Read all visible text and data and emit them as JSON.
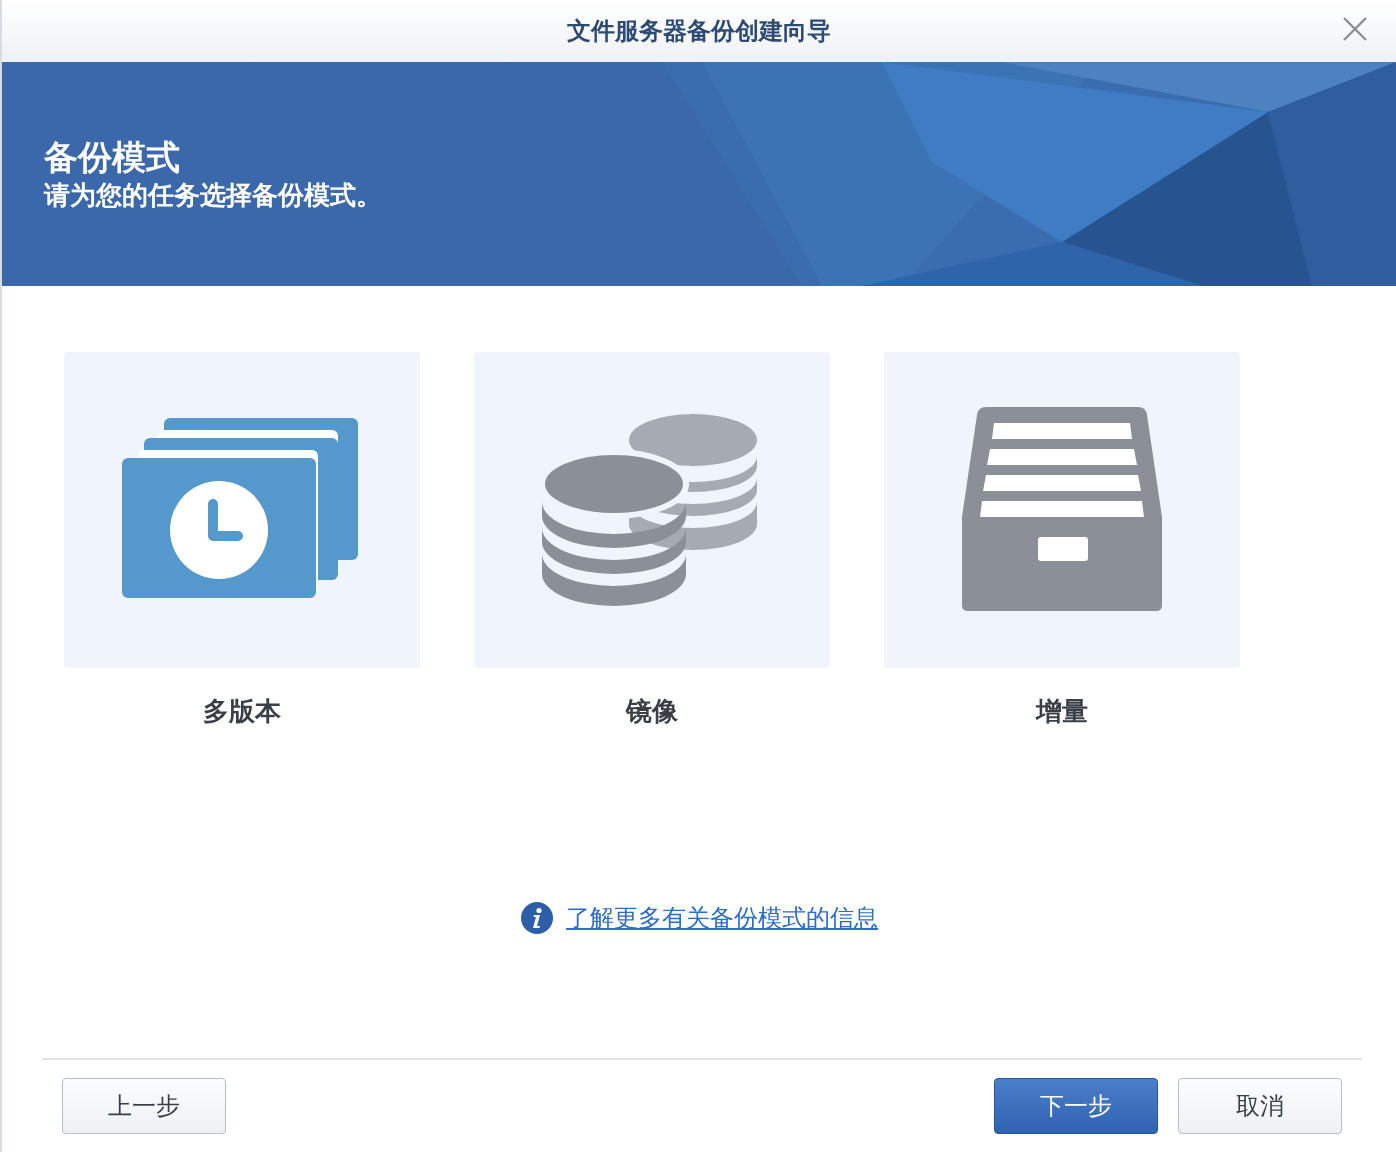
{
  "window": {
    "title": "文件服务器备份创建向导"
  },
  "banner": {
    "title": "备份模式",
    "subtitle": "请为您的任务选择备份模式。"
  },
  "modes": [
    {
      "kind": "versions",
      "label": "多版本",
      "selected": false
    },
    {
      "kind": "mirror",
      "label": "镜像",
      "selected": false
    },
    {
      "kind": "incremental",
      "label": "增量",
      "selected": false
    }
  ],
  "info_link": "了解更多有关备份模式的信息",
  "buttons": [
    {
      "kind": "back",
      "label": "上一步"
    },
    {
      "kind": "primary",
      "label": "下一步"
    },
    {
      "kind": "normal",
      "label": "取消"
    }
  ]
}
